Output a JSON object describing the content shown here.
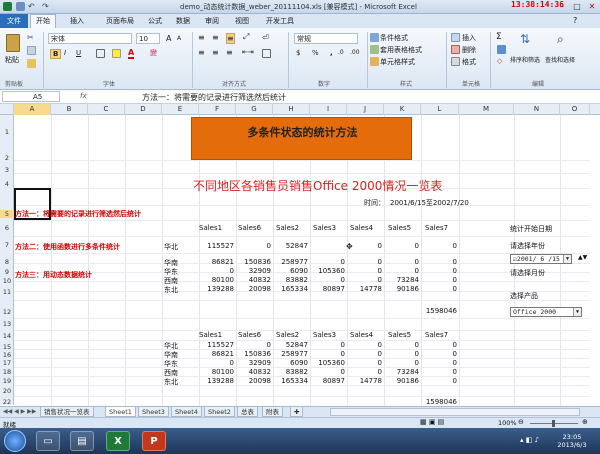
{
  "window": {
    "title": "demo_动态统计数据_weber_20111104.xls [兼容模式] - Microsoft Excel",
    "overlay_clock": "13:38:14:36"
  },
  "ribbon": {
    "tabs": [
      "文件",
      "开始",
      "插入",
      "页面布局",
      "公式",
      "数据",
      "审阅",
      "视图",
      "开发工具"
    ],
    "paste": "粘贴",
    "font_name": "宋体",
    "font_size": "10",
    "bold": "B",
    "italic": "I",
    "underline": "U",
    "number_format": "常规",
    "conditional_format": "条件格式",
    "format_as_table": "套用表格格式",
    "cell_styles": "单元格样式",
    "insert": "插入",
    "delete": "删除",
    "format": "格式",
    "sort_filter": "排序和筛选",
    "find_select": "查找和选择",
    "groups": [
      "剪贴板",
      "字体",
      "对齐方式",
      "数字",
      "样式",
      "单元格",
      "编辑"
    ]
  },
  "formula_bar": {
    "name_box": "A5",
    "content": "方法一：将需要的记录进行筛选然后统计"
  },
  "columns": [
    "A",
    "B",
    "C",
    "D",
    "E",
    "F",
    "G",
    "H",
    "I",
    "J",
    "K",
    "L",
    "M",
    "N",
    "O"
  ],
  "rows": [
    "1",
    "2",
    "3",
    "4",
    "5",
    "6",
    "7",
    "8",
    "9",
    "10",
    "11",
    "12",
    "13",
    "14",
    "15",
    "16",
    "17",
    "18",
    "19",
    "20",
    "22"
  ],
  "sheet": {
    "banner": "多条件状态的统计方法",
    "subtitle": "不同地区各销售员销售Office 2000情况一览表",
    "time_label": "时间：",
    "time_range": "2001/6/15至2002/7/20",
    "method1": "方法一：将需要的记录进行筛选然后统计",
    "method2": "方法二：使用函数进行多条件统计",
    "method3": "方法三：用动态数据统计",
    "start_date_label": "统计开始日期",
    "select_year_label": "请选择年份",
    "date_value": "2001/ 6 /15",
    "select_month_label": "请选择月份",
    "select_product_label": "选择产品",
    "product_value": "Office 2000"
  },
  "table1": {
    "headers": [
      "Sales1",
      "Sales6",
      "Sales2",
      "Sales3",
      "Sales4",
      "Sales5",
      "Sales7"
    ],
    "rows": [
      {
        "region": "华北",
        "values": [
          "115527",
          "0",
          "52847",
          "",
          "0",
          "0",
          "0"
        ]
      },
      {
        "region": "华南",
        "values": [
          "86821",
          "150836",
          "258977",
          "0",
          "0",
          "0",
          "0"
        ]
      },
      {
        "region": "华东",
        "values": [
          "0",
          "32909",
          "6090",
          "105360",
          "0",
          "0",
          "0"
        ]
      },
      {
        "region": "西南",
        "values": [
          "80100",
          "40832",
          "83882",
          "0",
          "0",
          "73284",
          "0"
        ]
      },
      {
        "region": "东北",
        "values": [
          "139288",
          "20098",
          "165334",
          "80897",
          "14778",
          "90186",
          "0"
        ]
      }
    ],
    "total": "1598046"
  },
  "table2": {
    "headers": [
      "Sales1",
      "Sales6",
      "Sales2",
      "Sales3",
      "Sales4",
      "Sales5",
      "Sales7"
    ],
    "rows": [
      {
        "region": "华北",
        "values": [
          "115527",
          "0",
          "52847",
          "0",
          "0",
          "0",
          "0"
        ]
      },
      {
        "region": "华南",
        "values": [
          "86821",
          "150836",
          "258977",
          "0",
          "0",
          "0",
          "0"
        ]
      },
      {
        "region": "华东",
        "values": [
          "0",
          "32909",
          "6090",
          "105360",
          "0",
          "0",
          "0"
        ]
      },
      {
        "region": "西南",
        "values": [
          "80100",
          "40832",
          "83882",
          "0",
          "0",
          "73284",
          "0"
        ]
      },
      {
        "region": "东北",
        "values": [
          "139288",
          "20098",
          "165334",
          "80897",
          "14778",
          "90186",
          "0"
        ]
      }
    ],
    "total": "1598046"
  },
  "sheet_tabs": [
    "销售状况一览表",
    "Sheet1",
    "Sheet3",
    "Sheet4",
    "Sheet2",
    "总表",
    "附表"
  ],
  "status": {
    "mode": "就绪",
    "zoom": "100%"
  },
  "taskbar": {
    "time": "23:05",
    "date": "2013/6/3"
  }
}
